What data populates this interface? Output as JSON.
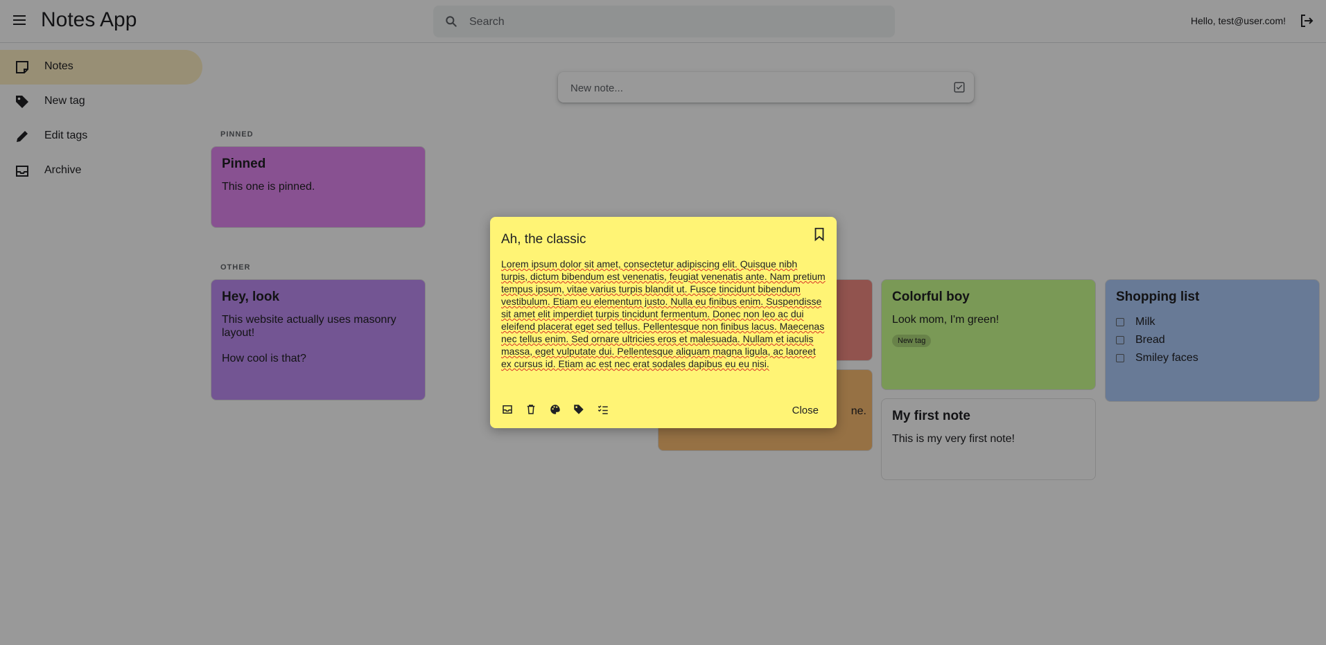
{
  "header": {
    "app_title": "Notes App",
    "search_placeholder": "Search",
    "greeting": "Hello, test@user.com!"
  },
  "sidebar": {
    "items": [
      {
        "label": "Notes",
        "icon": "sticky-note-icon",
        "active": true
      },
      {
        "label": "New tag",
        "icon": "tag-icon",
        "active": false
      },
      {
        "label": "Edit tags",
        "icon": "pencil-icon",
        "active": false
      },
      {
        "label": "Archive",
        "icon": "archive-icon",
        "active": false
      }
    ]
  },
  "new_note": {
    "placeholder": "New note..."
  },
  "sections": {
    "pinned": "PINNED",
    "other": "OTHER"
  },
  "notes": {
    "pinned": {
      "title": "Pinned",
      "body": "This one is pinned.",
      "color": "#e388f2"
    },
    "hey_look": {
      "title": "Hey, look",
      "body1": "This website actually uses masonry layout!",
      "body2": "How cool is that?",
      "color": "#c08ef5"
    },
    "colorful_boy": {
      "title": "Colorful boy",
      "body": "Look mom, I'm green!",
      "tag": "New tag",
      "color": "#ccff90"
    },
    "my_first_note": {
      "title": "My first note",
      "body": "This is my very first note!",
      "color": "#ffffff"
    },
    "shopping_list": {
      "title": "Shopping list",
      "items": [
        "Milk",
        "Bread",
        "Smiley faces"
      ],
      "color": "#aecbfa"
    },
    "hidden_orange": {
      "visible_text": "ne.",
      "color": "#fbbc72"
    },
    "hidden_red": {
      "color": "#f28b82"
    }
  },
  "modal": {
    "title": "Ah, the classic",
    "body": "Lorem ipsum dolor sit amet, consectetur adipiscing elit. Quisque nibh turpis, dictum bibendum est venenatis, feugiat venenatis ante. Nam pretium tempus ipsum, vitae varius turpis blandit ut. Fusce tincidunt bibendum vestibulum. Etiam eu elementum justo. Nulla eu finibus enim. Suspendisse sit amet elit imperdiet turpis tincidunt fermentum. Donec non leo ac dui eleifend placerat eget sed tellus. Pellentesque non finibus lacus. Maecenas nec tellus enim. Sed ornare ultricies eros et malesuada. Nullam et iaculis massa, eget vulputate dui. Pellentesque aliquam magna ligula, ac laoreet ex cursus id. Etiam ac est nec erat sodales dapibus eu eu nisi.",
    "close_label": "Close",
    "tools": [
      "archive-icon",
      "trash-icon",
      "palette-icon",
      "tag-icon",
      "checklist-icon"
    ],
    "color": "#fff475"
  }
}
